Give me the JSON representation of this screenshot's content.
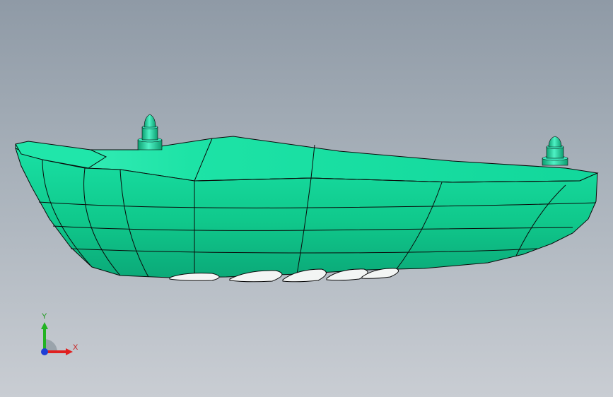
{
  "viewport": {
    "background_top": "#8f9aa6",
    "background_bottom": "#c9cdd3"
  },
  "model": {
    "color": "#12d99a",
    "edge_color": "#0a0a0a"
  },
  "triad": {
    "x_label": "X",
    "y_label": "Y",
    "x_color": "#e02020",
    "y_color": "#22b322",
    "z_color": "#1f3fd6"
  }
}
